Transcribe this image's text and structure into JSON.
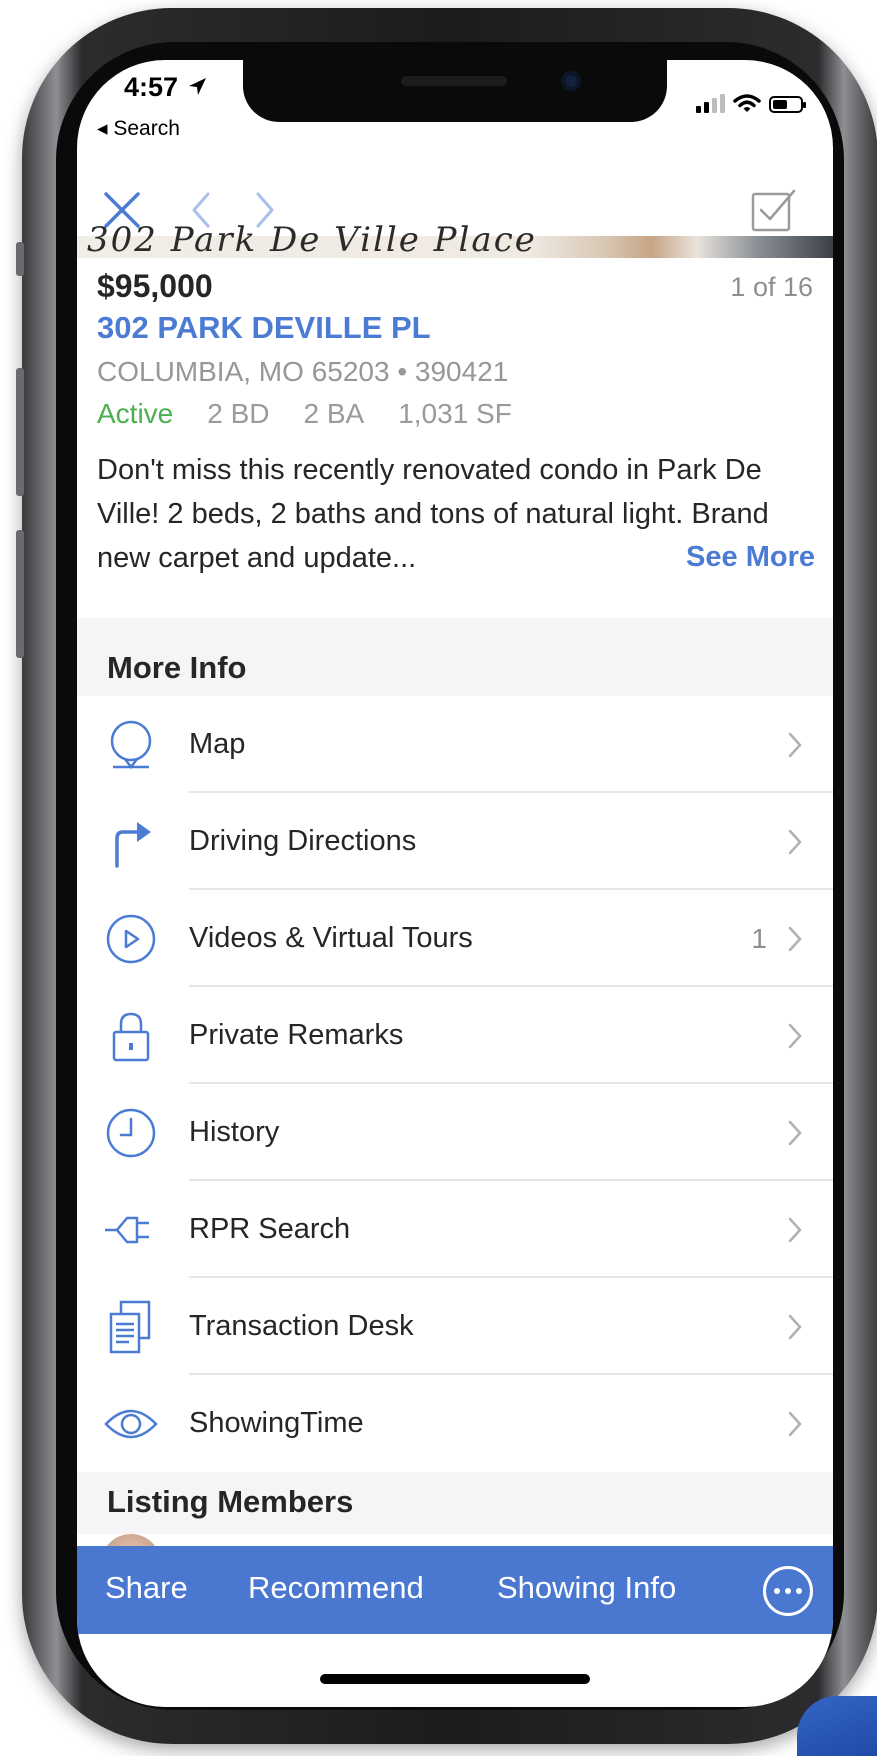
{
  "status_bar": {
    "time": "4:57",
    "back_app": "◂ Search"
  },
  "nav": {
    "close_icon": "close-icon",
    "prev_icon": "chevron-left-icon",
    "next_icon": "chevron-right-icon",
    "select_icon": "checkbox-checked-icon"
  },
  "listing": {
    "price": "$95,000",
    "counter": "1 of 16",
    "address": "302 PARK DEVILLE PL",
    "city_line": "COLUMBIA, MO 65203 • 390421",
    "status": "Active",
    "beds": "2 BD",
    "baths": "2 BA",
    "sqft": "1,031 SF",
    "description": "Don't miss this recently renovated condo in Park De Ville! 2 beds, 2 baths and tons of natural light. Brand new carpet and update...",
    "see_more": "See More"
  },
  "more_info": {
    "title": "More Info",
    "items": [
      {
        "label": "Map",
        "icon": "map-pin-icon",
        "count": ""
      },
      {
        "label": "Driving Directions",
        "icon": "turn-right-arrow-icon",
        "count": ""
      },
      {
        "label": "Videos & Virtual Tours",
        "icon": "play-circle-icon",
        "count": "1"
      },
      {
        "label": "Private Remarks",
        "icon": "lock-icon",
        "count": ""
      },
      {
        "label": "History",
        "icon": "clock-icon",
        "count": ""
      },
      {
        "label": "RPR Search",
        "icon": "plug-icon",
        "count": ""
      },
      {
        "label": "Transaction Desk",
        "icon": "documents-icon",
        "count": ""
      },
      {
        "label": "ShowingTime",
        "icon": "eye-icon",
        "count": ""
      }
    ]
  },
  "listing_members": {
    "title": "Listing Members"
  },
  "toolbar": {
    "share": "Share",
    "recommend": "Recommend",
    "showing_info": "Showing Info",
    "more_icon": "more-circle-icon"
  },
  "colors": {
    "accent": "#4a78d0",
    "active": "#4caf50",
    "link": "#4c7bd4"
  }
}
